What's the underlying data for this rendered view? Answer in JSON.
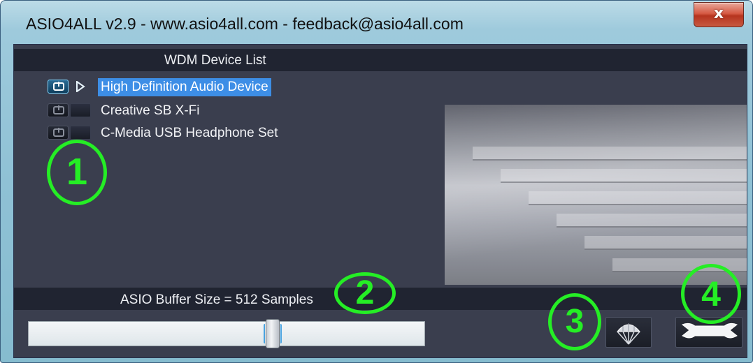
{
  "window": {
    "title": "ASIO4ALL v2.9 - www.asio4all.com - feedback@asio4all.com",
    "close_label": "x"
  },
  "device_list": {
    "header": "WDM Device List",
    "devices": [
      {
        "label": "High Definition Audio Device",
        "enabled": true,
        "selected": true
      },
      {
        "label": "Creative SB X-Fi",
        "enabled": false,
        "selected": false
      },
      {
        "label": "C-Media USB Headphone Set",
        "enabled": false,
        "selected": false
      }
    ]
  },
  "buffer": {
    "header": "ASIO Buffer Size = 512 Samples",
    "slider_position_fraction": 0.62
  },
  "toolbar": {
    "parachute_icon": "parachute-icon",
    "settings_icon": "wrench-icon"
  },
  "annotations": {
    "one": "1",
    "two": "2",
    "three": "3",
    "four": "4"
  },
  "colors": {
    "selection": "#3d8ee6",
    "annotation": "#25ee25",
    "panel_bg": "#3a3e4e"
  }
}
